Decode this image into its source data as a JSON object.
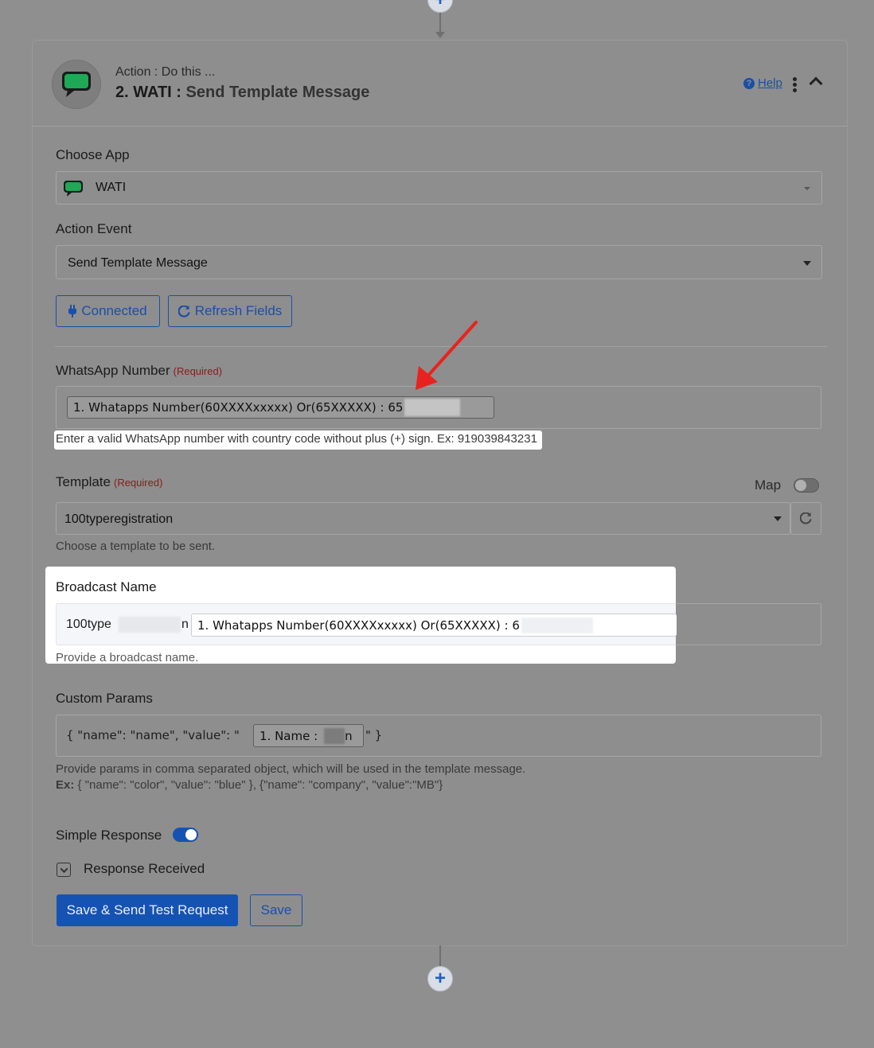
{
  "header": {
    "subtitle": "Action : Do this ...",
    "step_number": "2. WATI :",
    "event_name": "Send Template Message",
    "help_label": "Help",
    "help_icon": "question-circle-icon"
  },
  "choose_app": {
    "label": "Choose App",
    "value": "WATI"
  },
  "action_event": {
    "label": "Action Event",
    "value": "Send Template Message"
  },
  "buttons": {
    "connected": "Connected",
    "refresh_fields": "Refresh Fields",
    "save_send": "Save & Send Test Request",
    "save": "Save"
  },
  "whatsapp_number": {
    "label": "WhatsApp Number",
    "required": "(Required)",
    "chip": "1. Whatapps Number(60XXXXxxxxx) Or(65XXXXX) : 65",
    "hint": "Enter a valid WhatsApp number with country code without plus (+) sign. Ex: 919039843231"
  },
  "template": {
    "label": "Template",
    "required": "(Required)",
    "map_label": "Map",
    "value": "100typeregistration",
    "hint": "Choose a template to be sent."
  },
  "broadcast_name": {
    "label": "Broadcast Name",
    "prefix": "100type",
    "suffix_char": "n",
    "chip": "1. Whatapps Number(60XXXXxxxxx) Or(65XXXXX) : 6",
    "hint": "Provide a broadcast name."
  },
  "custom_params": {
    "label": "Custom Params",
    "text_before": "{ \"name\": \"name\", \"value\": \"",
    "chip": "1. Name :",
    "chip_end": "n",
    "text_after": "\" }",
    "hint": "Provide params in comma separated object, which will be used in the template message.",
    "example_label": "Ex:",
    "example": " { \"name\": \"color\", \"value\": \"blue\" }, {\"name\": \"company\", \"value\":\"MB\"}"
  },
  "simple_response": {
    "label": "Simple Response",
    "enabled": true
  },
  "response_received": {
    "label": "Response Received"
  },
  "colors": {
    "accent": "#1553b3",
    "required": "#8b1a1a",
    "wati_green": "#1fa855",
    "annotation_arrow": "#e8231f"
  }
}
